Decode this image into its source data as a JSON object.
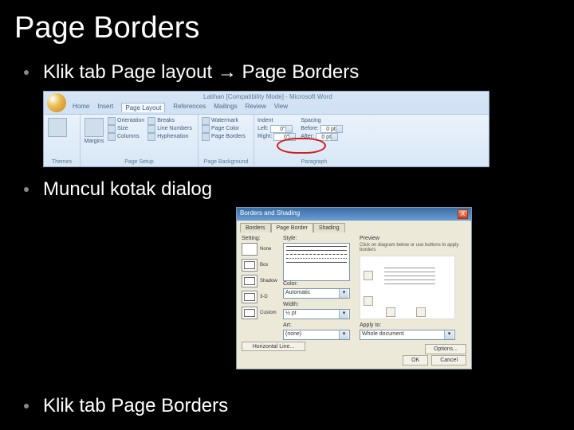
{
  "title": "Page Borders",
  "bullets": {
    "b1_pre": "Klik tab Page layout ",
    "b1_arrow": "→",
    "b1_post": " Page Borders",
    "b2": "Muncul kotak dialog",
    "b3": "Klik tab Page Borders"
  },
  "ribbon": {
    "window_title": "Latihan [Compatibility Mode] - Microsoft Word",
    "tabs": [
      "Home",
      "Insert",
      "Page Layout",
      "References",
      "Mailings",
      "Review",
      "View"
    ],
    "groups": {
      "themes": "Themes",
      "page_setup": "Page Setup",
      "page_background": "Page Background",
      "paragraph": "Paragraph"
    },
    "items": {
      "orientation": "Orientation",
      "size": "Size",
      "columns": "Columns",
      "breaks": "Breaks",
      "line_numbers": "Line Numbers",
      "hyphenation": "Hyphenation",
      "margins": "Margins",
      "watermark": "Watermark",
      "page_color": "Page Color",
      "page_borders": "Page Borders",
      "indent": "Indent",
      "spacing": "Spacing",
      "left": "Left:",
      "right": "Right:",
      "before": "Before:",
      "after": "After:",
      "zero_in": "0\"",
      "zero_pt": "0 pt"
    }
  },
  "dialog": {
    "title": "Borders and Shading",
    "tabs": [
      "Borders",
      "Page Border",
      "Shading"
    ],
    "labels": {
      "setting": "Setting:",
      "style": "Style:",
      "color": "Color:",
      "width": "Width:",
      "art": "Art:",
      "preview": "Preview",
      "apply_to": "Apply to:"
    },
    "settings": [
      "None",
      "Box",
      "Shadow",
      "3-D",
      "Custom"
    ],
    "color_value": "Automatic",
    "width_value": "½ pt",
    "art_value": "(none)",
    "apply_value": "Whole document",
    "hint": "Click on diagram below or use buttons to apply borders",
    "buttons": {
      "options": "Options...",
      "ok": "OK",
      "cancel": "Cancel",
      "hline": "Horizontal Line..."
    },
    "close_x": "X"
  }
}
